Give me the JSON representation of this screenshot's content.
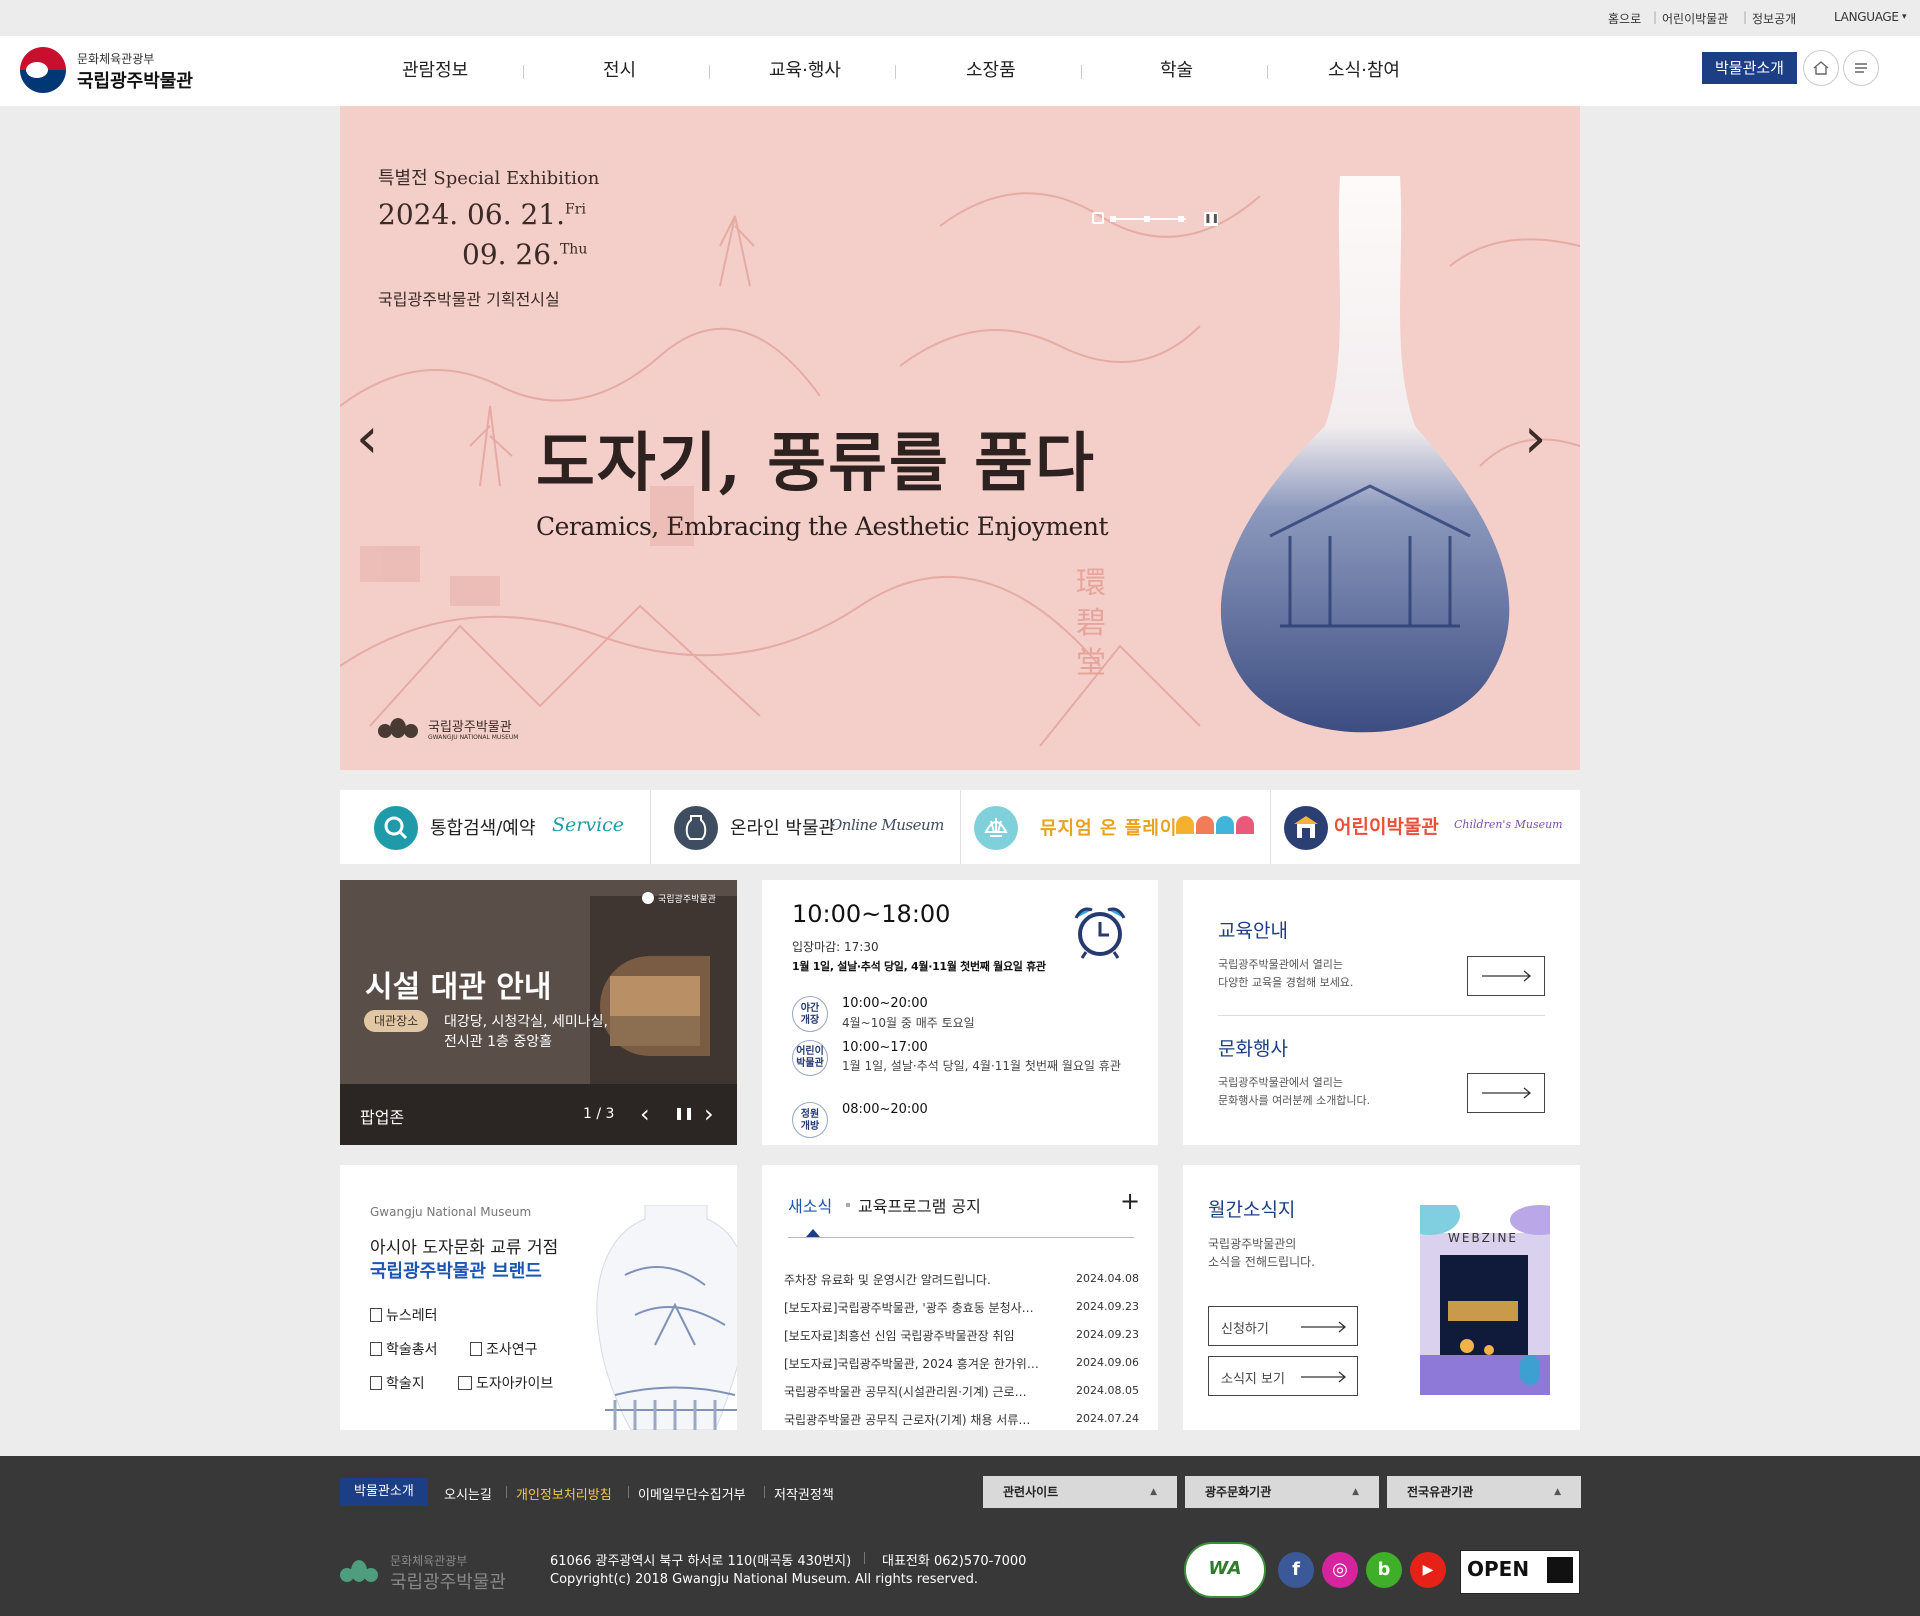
{
  "util": {
    "home": "홈으로",
    "kids": "어린이박물관",
    "info": "정보공개",
    "language": "LANGUAGE"
  },
  "header": {
    "ministry": "문화체육관광부",
    "museum": "국립광주박물관",
    "nav": [
      "관람정보",
      "전시",
      "교육·행사",
      "소장품",
      "학술",
      "소식·참여"
    ],
    "intro_button": "박물관소개"
  },
  "hero": {
    "label": "특별전 Special Exhibition",
    "date1": "2024. 06. 21.",
    "date1_day": "Fri",
    "date2": "09. 26.",
    "date2_day": "Thu",
    "venue": "국립광주박물관 기획전시실",
    "title_ko": "도자기, 풍류를 품다",
    "title_en": "Ceramics, Embracing the Aesthetic Enjoyment",
    "seal": "環碧堂",
    "logo_ko": "국립광주박물관",
    "logo_en": "GWANGJU NATIONAL MUSEUM"
  },
  "quick": [
    {
      "label": "통합검색/예약",
      "sub": "Service",
      "color": "#1f9aa8"
    },
    {
      "label": "온라인 박물관",
      "sub": "Online Museum",
      "color": "#3f4d61"
    },
    {
      "label": "뮤지엄 온 플레이",
      "sub": "",
      "color": "#7fd0da"
    },
    {
      "label": "어린이박물관",
      "sub": "Children's Museum",
      "color": "#2b3f73"
    }
  ],
  "popup": {
    "badge": "국립광주박물관",
    "title": "시설 대관 안내",
    "tag": "대관장소",
    "place1": "대강당, 시청각실, 세미나실,",
    "place2": "전시관 1층 중앙홀",
    "zone": "팝업존",
    "counter": "1 / 3"
  },
  "hours": {
    "main": "10:00~18:00",
    "deadline": "입장마감: 17:30",
    "closed": "1월 1일, 설날·추석 당일, 4월·11월 첫번째 월요일 휴관",
    "items": [
      {
        "tag": "야간 개장",
        "time": "10:00~20:00",
        "note": "4월~10월 중 매주 토요일"
      },
      {
        "tag": "어린이 박물관",
        "time": "10:00~17:00",
        "note": "1월 1일, 설날·추석 당일, 4월·11월 첫번째 월요일 휴관"
      },
      {
        "tag": "정원 개방",
        "time": "08:00~20:00",
        "note": ""
      }
    ]
  },
  "edu": {
    "title1": "교육안내",
    "desc1a": "국립광주박물관에서 열리는",
    "desc1b": "다양한 교육을 경험해 보세요.",
    "title2": "문화행사",
    "desc2a": "국립광주박물관에서 열리는",
    "desc2b": "문화행사를 여러분께 소개합니다."
  },
  "brand": {
    "en": "Gwangju National Museum",
    "line1": "아시아 도자문화 교류 거점",
    "line2": "국립광주박물관 브랜드",
    "links": [
      "뉴스레터",
      "학술총서",
      "조사연구",
      "학술지",
      "도자아카이브"
    ]
  },
  "news": {
    "tab1": "새소식",
    "tab2": "교육프로그램 공지",
    "more": "+",
    "items": [
      {
        "title": "주차장 유료화 및 운영시간 알려드립니다.",
        "date": "2024.04.08"
      },
      {
        "title": "[보도자료]국립광주박물관, '광주 충효동 분청사…",
        "date": "2024.09.23"
      },
      {
        "title": "[보도자료]최흥선 신임 국립광주박물관장 취임",
        "date": "2024.09.23"
      },
      {
        "title": "[보도자료]국립광주박물관, 2024 흥겨운 한가위…",
        "date": "2024.09.06"
      },
      {
        "title": "국립광주박물관 공무직(시설관리원·기계) 근로…",
        "date": "2024.08.05"
      },
      {
        "title": "국립광주박물관 공무직 근로자(기계) 채용 서류…",
        "date": "2024.07.24"
      }
    ]
  },
  "monthly": {
    "title": "월간소식지",
    "desc1": "국립광주박물관의",
    "desc2": "소식을 전해드립니다.",
    "btn1": "신청하기",
    "btn2": "소식지 보기",
    "webzine": "WEBZINE"
  },
  "footer": {
    "links": [
      "박물관소개",
      "오시는길",
      "개인정보처리방침",
      "이메일무단수집거부",
      "저작권정책"
    ],
    "dropdowns": [
      "관련사이트",
      "광주문화기관",
      "전국유관기관"
    ],
    "ministry": "문화체육관광부",
    "museum": "국립광주박물관",
    "address": "61066 광주광역시 북구 하서로 110(매곡동 430번지)",
    "tel": "대표전화 062)570-7000",
    "copyright": "Copyright(c) 2018 Gwangju National Museum. All rights reserved.",
    "sns": [
      {
        "name": "facebook",
        "glyph": "f",
        "color": "#3b5998"
      },
      {
        "name": "instagram",
        "glyph": "◎",
        "color": "#d6249f"
      },
      {
        "name": "blog",
        "glyph": "b",
        "color": "#3fae29"
      },
      {
        "name": "youtube",
        "glyph": "▶",
        "color": "#e62117"
      }
    ],
    "wa": "WA",
    "open": "OPEN"
  }
}
